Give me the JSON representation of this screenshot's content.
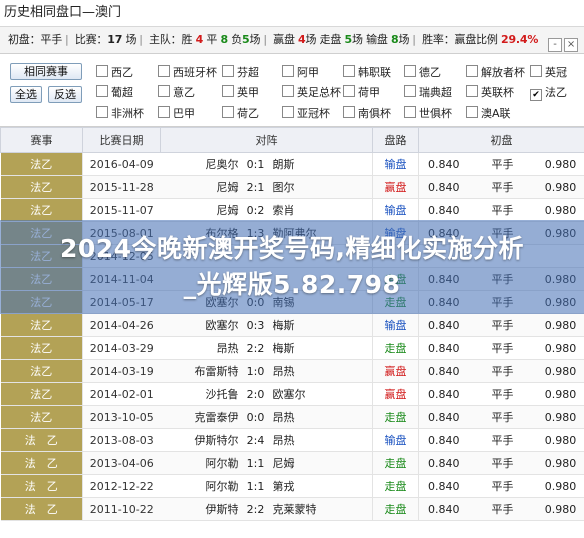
{
  "window": {
    "title": "历史相同盘口—澳门"
  },
  "summary": {
    "init_pan_label": "初盘：",
    "init_pan_value": "平手",
    "games_label": "比赛：",
    "games_value": "17",
    "games_unit": "场",
    "home_label": "主队：",
    "win_label": "胜",
    "win_value": "4",
    "draw_label": "平",
    "draw_value": "8",
    "lose_label": "负",
    "lose_value": "5",
    "unit": "场",
    "ying_label": "赢盘",
    "ying_value": "4",
    "zou_label": "走盘",
    "zou_value": "5",
    "shu_label": "输盘",
    "shu_value": "8",
    "ratio_label": "胜率：",
    "ratio_sub": "赢盘比例",
    "ratio_value": "29.4%",
    "ctrl_min": "-",
    "ctrl_close": "×"
  },
  "filter": {
    "buttons": {
      "same_league": "相同赛事",
      "select_all": "全选",
      "invert": "反选"
    },
    "leagues": [
      {
        "name": "西乙",
        "checked": false
      },
      {
        "name": "西班牙杯",
        "checked": false
      },
      {
        "name": "芬超",
        "checked": false
      },
      {
        "name": "阿甲",
        "checked": false
      },
      {
        "name": "韩职联",
        "checked": false
      },
      {
        "name": "德乙",
        "checked": false
      },
      {
        "name": "解放者杯",
        "checked": false
      },
      {
        "name": "英冠",
        "checked": false
      },
      {
        "name": "葡超",
        "checked": false
      },
      {
        "name": "意乙",
        "checked": false
      },
      {
        "name": "英甲",
        "checked": false
      },
      {
        "name": "英足总杯",
        "checked": false
      },
      {
        "name": "荷甲",
        "checked": false
      },
      {
        "name": "瑞典超",
        "checked": false
      },
      {
        "name": "英联杯",
        "checked": false
      },
      {
        "name": "法乙",
        "checked": true
      },
      {
        "name": "非洲杯",
        "checked": false
      },
      {
        "name": "巴甲",
        "checked": false
      },
      {
        "name": "荷乙",
        "checked": false
      },
      {
        "name": "亚冠杯",
        "checked": false
      },
      {
        "name": "南俱杯",
        "checked": false
      },
      {
        "name": "世俱杯",
        "checked": false
      },
      {
        "name": "澳A联",
        "checked": false
      }
    ]
  },
  "table": {
    "headers": [
      "赛事",
      "比赛日期",
      "对阵",
      "盘路",
      "",
      "初盘",
      ""
    ],
    "rows": [
      {
        "league": "法乙",
        "date": "2016-04-09",
        "home": "尼奥尔",
        "score": "0:1",
        "away": "朗斯",
        "pan": "输盘",
        "pan_type": "lose",
        "h": "0.840",
        "line": "平手",
        "a": "0.980"
      },
      {
        "league": "法乙",
        "date": "2015-11-28",
        "home": "尼姆",
        "score": "2:1",
        "away": "图尔",
        "pan": "赢盘",
        "pan_type": "win",
        "h": "0.840",
        "line": "平手",
        "a": "0.980"
      },
      {
        "league": "法乙",
        "date": "2015-11-07",
        "home": "尼姆",
        "score": "0:2",
        "away": "索肖",
        "pan": "输盘",
        "pan_type": "lose",
        "h": "0.840",
        "line": "平手",
        "a": "0.980"
      },
      {
        "league": "法乙",
        "date": "2015-08-01",
        "home": "布尔格",
        "score": "1:3",
        "away": "勒阿弗尔",
        "pan": "输盘",
        "pan_type": "lose",
        "h": "0.840",
        "line": "平手",
        "a": "0.980"
      },
      {
        "league": "法乙",
        "date": "2014-12-05",
        "home": "",
        "score": "",
        "away": "",
        "pan": "",
        "pan_type": "lose",
        "h": "",
        "line": "",
        "a": ""
      },
      {
        "league": "法乙",
        "date": "2014-11-04",
        "home": "",
        "score": "",
        "away": "",
        "pan": "走盘",
        "pan_type": "draw",
        "h": "0.840",
        "line": "平手",
        "a": "0.980"
      },
      {
        "league": "法乙",
        "date": "2014-05-17",
        "home": "欧塞尔",
        "score": "0:0",
        "away": "南锡",
        "pan": "走盘",
        "pan_type": "draw",
        "h": "0.840",
        "line": "平手",
        "a": "0.980"
      },
      {
        "league": "法乙",
        "date": "2014-04-26",
        "home": "欧塞尔",
        "score": "0:3",
        "away": "梅斯",
        "pan": "输盘",
        "pan_type": "lose",
        "h": "0.840",
        "line": "平手",
        "a": "0.980"
      },
      {
        "league": "法乙",
        "date": "2014-03-29",
        "home": "昂热",
        "score": "2:2",
        "away": "梅斯",
        "pan": "走盘",
        "pan_type": "draw",
        "h": "0.840",
        "line": "平手",
        "a": "0.980"
      },
      {
        "league": "法乙",
        "date": "2014-03-19",
        "home": "布雷斯特",
        "score": "1:0",
        "away": "昂热",
        "pan": "赢盘",
        "pan_type": "win",
        "h": "0.840",
        "line": "平手",
        "a": "0.980"
      },
      {
        "league": "法乙",
        "date": "2014-02-01",
        "home": "沙托鲁",
        "score": "2:0",
        "away": "欧塞尔",
        "pan": "赢盘",
        "pan_type": "win",
        "h": "0.840",
        "line": "平手",
        "a": "0.980"
      },
      {
        "league": "法乙",
        "date": "2013-10-05",
        "home": "克雷泰伊",
        "score": "0:0",
        "away": "昂热",
        "pan": "走盘",
        "pan_type": "draw",
        "h": "0.840",
        "line": "平手",
        "a": "0.980"
      },
      {
        "league": "法　乙",
        "date": "2013-08-03",
        "home": "伊斯特尔",
        "score": "2:4",
        "away": "昂热",
        "pan": "输盘",
        "pan_type": "lose",
        "h": "0.840",
        "line": "平手",
        "a": "0.980"
      },
      {
        "league": "法　乙",
        "date": "2013-04-06",
        "home": "阿尔勒",
        "score": "1:1",
        "away": "尼姆",
        "pan": "走盘",
        "pan_type": "draw",
        "h": "0.840",
        "line": "平手",
        "a": "0.980"
      },
      {
        "league": "法　乙",
        "date": "2012-12-22",
        "home": "阿尔勒",
        "score": "1:1",
        "away": "第戎",
        "pan": "走盘",
        "pan_type": "draw",
        "h": "0.840",
        "line": "平手",
        "a": "0.980"
      },
      {
        "league": "法　乙",
        "date": "2011-10-22",
        "home": "伊斯特",
        "score": "2:2",
        "away": "克莱蒙特",
        "pan": "走盘",
        "pan_type": "draw",
        "h": "0.840",
        "line": "平手",
        "a": "0.980"
      }
    ]
  },
  "overlay": {
    "line1": "2024今晚新澳开奖号码,精细化实施分析",
    "line2": "_光辉版5.82.798"
  }
}
